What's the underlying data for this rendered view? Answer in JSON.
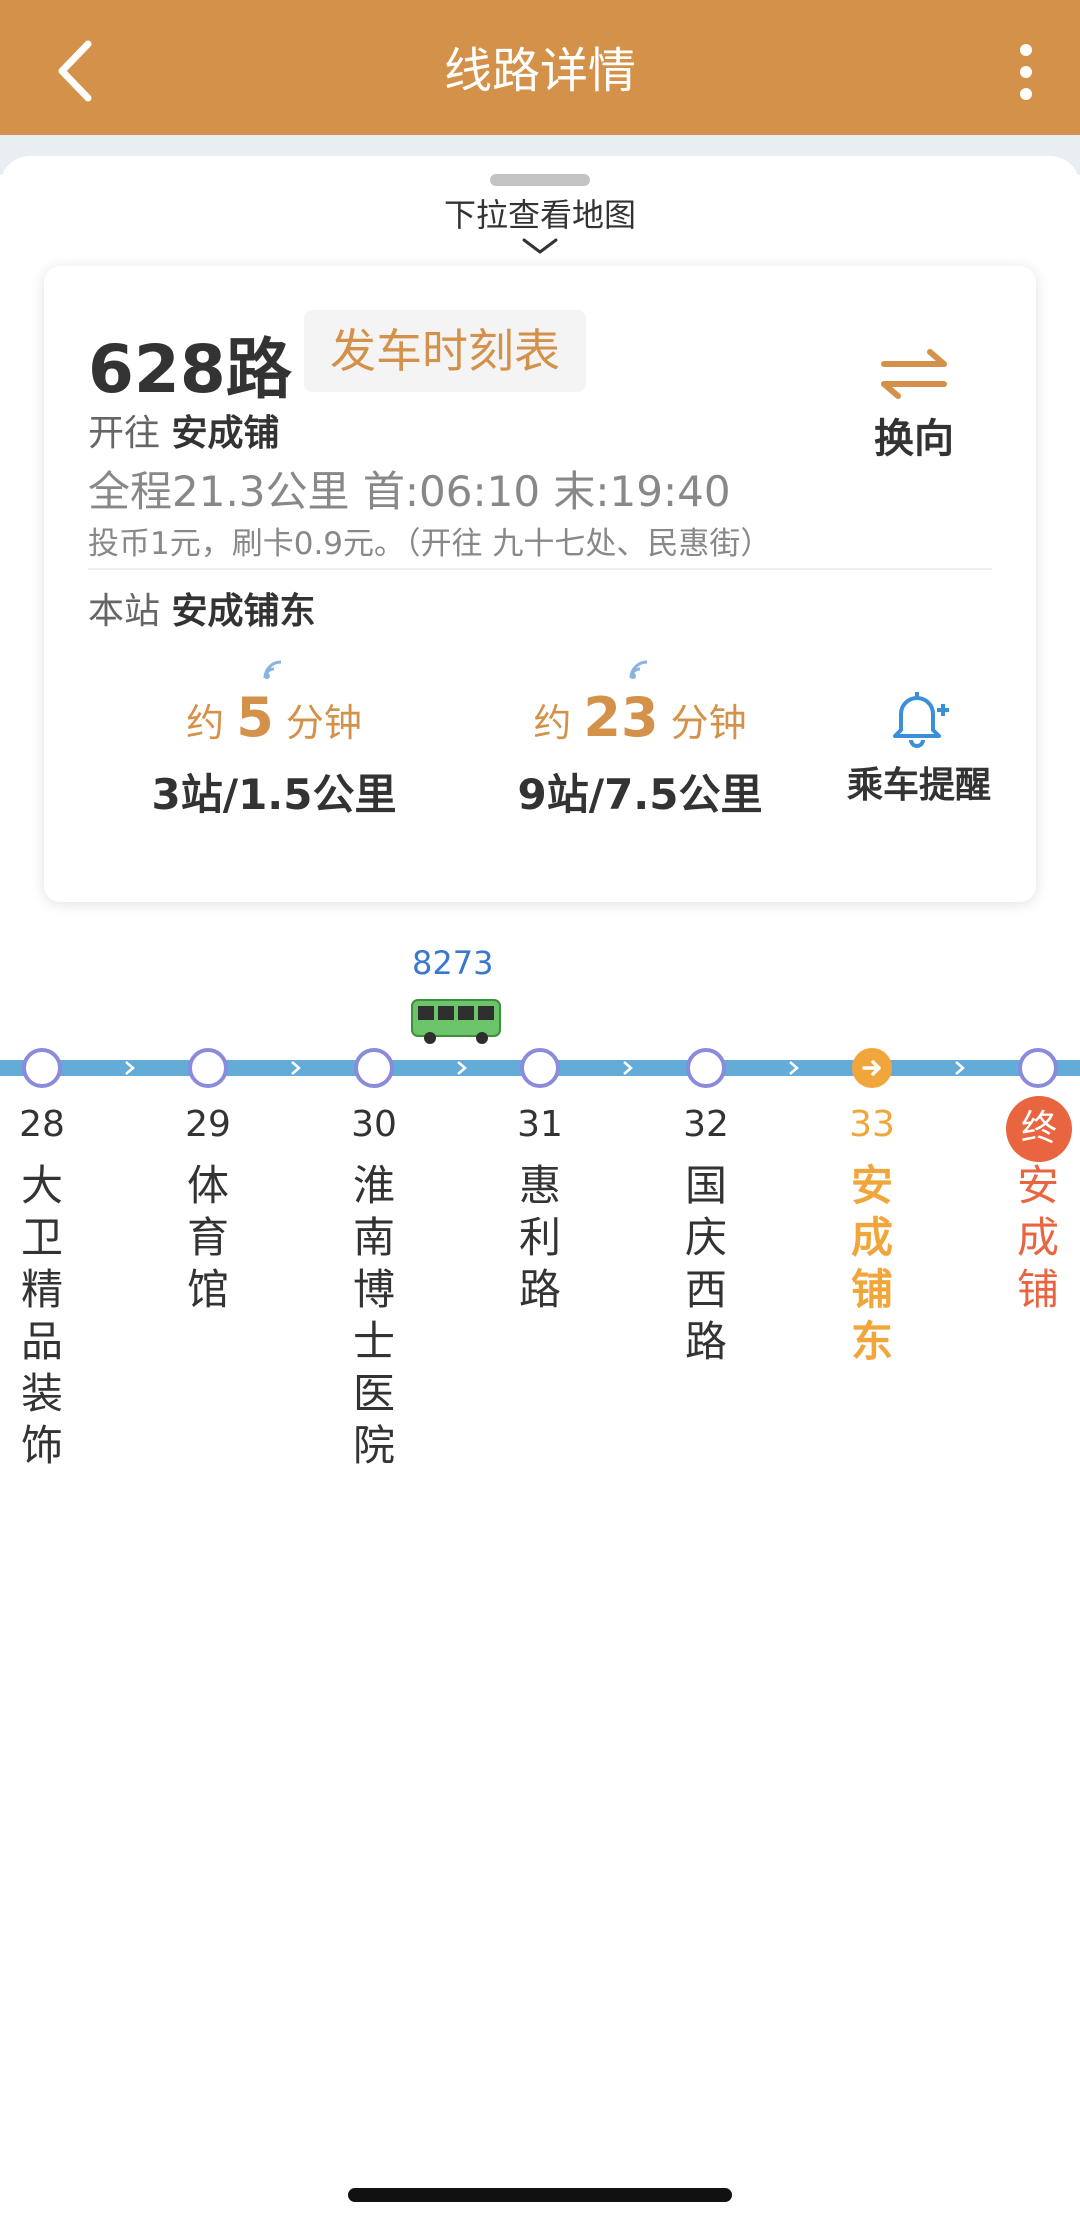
{
  "header": {
    "title": "线路详情"
  },
  "sheet": {
    "pull_hint": "下拉查看地图"
  },
  "route": {
    "number": "628路",
    "schedule_label": "发车时刻表",
    "direction_label": "开往",
    "destination": "安成铺",
    "summary": "全程21.3公里 首:06:10 末:19:40",
    "fare": "投币1元，刷卡0.9元。（开往 九十七处、民惠街）",
    "switch_label": "换向",
    "station_label": "本站",
    "station_name": "安成铺东",
    "reminder_label": "乘车提醒"
  },
  "arrivals": [
    {
      "prefix": "约",
      "minutes": "5",
      "unit": "分钟",
      "distance": "3站/1.5公里"
    },
    {
      "prefix": "约",
      "minutes": "23",
      "unit": "分钟",
      "distance": "9站/7.5公里"
    }
  ],
  "bus": {
    "plate": "8273"
  },
  "stops": [
    {
      "seq": "28",
      "name": "大卫精品装饰"
    },
    {
      "seq": "29",
      "name": "体育馆"
    },
    {
      "seq": "30",
      "name": "淮南博士医院"
    },
    {
      "seq": "31",
      "name": "惠利路"
    },
    {
      "seq": "32",
      "name": "国庆西路"
    },
    {
      "seq": "33",
      "name": "安成铺东"
    },
    {
      "seq": "",
      "name": "安成铺",
      "badge": "终"
    }
  ],
  "colors": {
    "brand": "#d4914a",
    "current_stop": "#f0a63a",
    "terminal": "#e8653f",
    "track": "#64acd8",
    "bus_plate": "#3a78d0"
  }
}
